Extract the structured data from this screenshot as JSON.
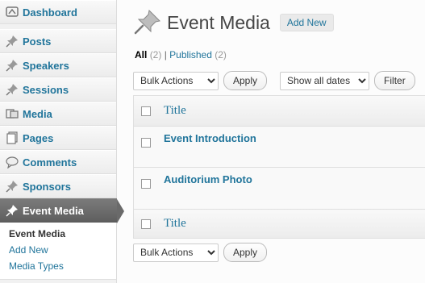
{
  "sidebar": {
    "items": [
      {
        "name": "dashboard",
        "label": "Dashboard",
        "icon": "dashboard-icon"
      },
      {
        "name": "posts",
        "label": "Posts",
        "icon": "pin-icon"
      },
      {
        "name": "speakers",
        "label": "Speakers",
        "icon": "pin-icon"
      },
      {
        "name": "sessions",
        "label": "Sessions",
        "icon": "pin-icon"
      },
      {
        "name": "media",
        "label": "Media",
        "icon": "media-icon"
      },
      {
        "name": "pages",
        "label": "Pages",
        "icon": "pages-icon"
      },
      {
        "name": "comments",
        "label": "Comments",
        "icon": "comments-icon"
      },
      {
        "name": "sponsors",
        "label": "Sponsors",
        "icon": "pin-icon"
      },
      {
        "name": "event-media",
        "label": "Event Media",
        "icon": "pin-icon"
      }
    ],
    "submenu": [
      "Event Media",
      "Add New",
      "Media Types"
    ]
  },
  "header": {
    "title": "Event Media",
    "add_new": "Add New"
  },
  "filters": {
    "all_label": "All",
    "all_count": "(2)",
    "separator": "|",
    "published_label": "Published",
    "published_count": "(2)"
  },
  "toolbar": {
    "bulk_actions": "Bulk Actions",
    "apply": "Apply",
    "dates": "Show all dates",
    "filter": "Filter"
  },
  "table": {
    "column_title": "Title",
    "rows": [
      "Event Introduction",
      "Auditorium Photo"
    ]
  },
  "colors": {
    "link": "#21759b",
    "active_menu": "#6a6a6a"
  }
}
